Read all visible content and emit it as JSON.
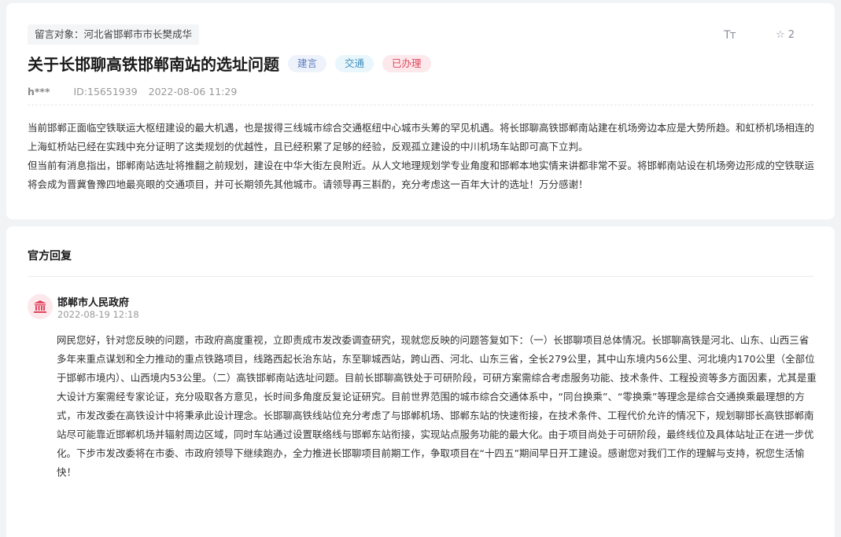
{
  "message": {
    "recipient": "留言对象：河北省邯郸市市长樊成华",
    "font_size_icon": "Tт",
    "favorite_icon": "☆",
    "favorite_count": "2",
    "title": "关于长邯聊高铁邯郸南站的选址问题",
    "tags": [
      "建言",
      "交通",
      "已办理"
    ],
    "author": "h***",
    "id": "ID:15651939",
    "datetime": "2022-08-06 11:29",
    "paragraphs": [
      "当前邯郸正面临空铁联运大枢纽建设的最大机遇，也是拔得三线城市综合交通枢纽中心城市头筹的罕见机遇。将长邯聊高铁邯郸南站建在机场旁边本应是大势所趋。和虹桥机场相连的上海虹桥站已经在实践中充分证明了这类规划的优越性，且已经积累了足够的经验，反观孤立建设的中川机场车站即可高下立判。",
      "但当前有消息指出，邯郸南站选址将推翻之前规划，建设在中华大街左良附近。从人文地理规划学专业角度和邯郸本地实情来讲都非常不妥。将邯郸南站设在机场旁边形成的空铁联运将会成为晋冀鲁豫四地最亮眼的交通项目，并可长期领先其他城市。请领导再三斟酌，充分考虑这一百年大计的选址！万分感谢！"
    ]
  },
  "reply": {
    "heading": "官方回复",
    "responder": "邯郸市人民政府",
    "datetime": "2022-08-19 12:18",
    "body": "网民您好，针对您反映的问题，市政府高度重视，立即责成市发改委调查研究，现就您反映的问题答复如下：（一）长邯聊项目总体情况。长邯聊高铁是河北、山东、山西三省多年来重点谋划和全力推动的重点铁路项目，线路西起长治东站，东至聊城西站，跨山西、河北、山东三省，全长279公里，其中山东境内56公里、河北境内170公里（全部位于邯郸市境内）、山西境内53公里。（二）高铁邯郸南站选址问题。目前长邯聊高铁处于可研阶段，可研方案需综合考虑服务功能、技术条件、工程投资等多方面因素，尤其是重大设计方案需经专家论证，充分吸取各方意见，长时间多角度反复论证研究。目前世界范围的城市综合交通体系中，“同台换乘”、“零换乘”等理念是综合交通换乘最理想的方式，市发改委在高铁设计中将秉承此设计理念。长邯聊高铁线站位充分考虑了与邯郸机场、邯郸东站的快速衔接，在技术条件、工程代价允许的情况下，规划聊邯长高铁邯郸南站尽可能靠近邯郸机场并辐射周边区域，同时车站通过设置联络线与邯郸东站衔接，实现站点服务功能的最大化。由于项目尚处于可研阶段，最终线位及具体站址正在进一步优化。下步市发改委将在市委、市政府领导下继续跑办，全力推进长邯聊项目前期工作，争取项目在“十四五”期间早日开工建设。感谢您对我们工作的理解与支持，祝您生活愉快！"
  },
  "colors": {
    "page_bg": "#f2f3f5",
    "tag_blue": "#5a7cc0",
    "tag_cyan": "#3f8fbf",
    "tag_red": "#e0455e",
    "gov_icon": "#e0455e"
  },
  "icons": {
    "font_size": "font-size-icon",
    "favorite": "star-icon",
    "government": "government-building-icon"
  }
}
